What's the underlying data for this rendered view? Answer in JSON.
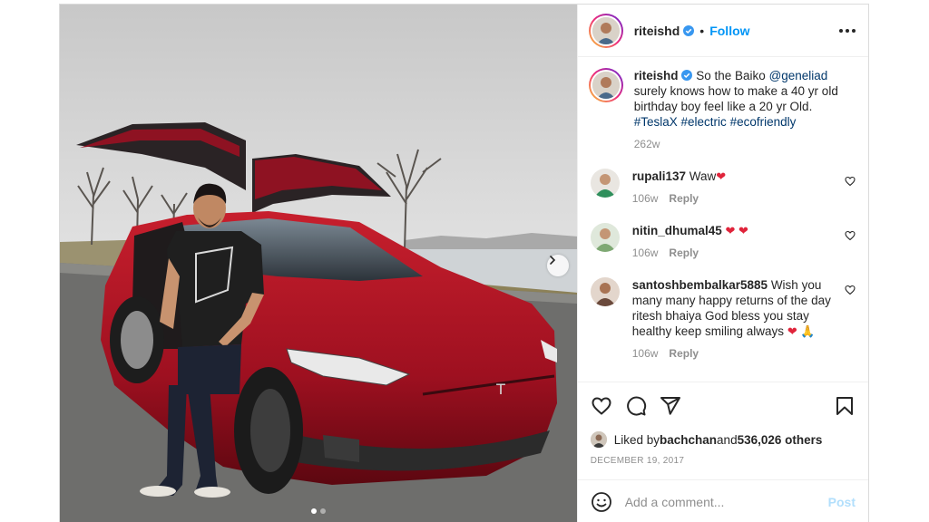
{
  "post": {
    "author": "riteishd",
    "follow_label": "Follow",
    "separator": "•",
    "photo_alt": "Man in black t-shirt leaning on a red Tesla Model X with falcon-wing doors open by a lake",
    "carousel": {
      "count": 2,
      "active_index": 0
    }
  },
  "caption": {
    "author": "riteishd",
    "text_before": "So the Baiko ",
    "mention": "@geneliad",
    "text_after": " surely knows how to make a 40 yr old birthday boy feel like a 20 yr Old. ",
    "hashtags": [
      "#TeslaX",
      "#electric",
      "#ecofriendly"
    ],
    "age": "262w"
  },
  "comments": [
    {
      "user": "rupali137",
      "text": "Waw",
      "emoji": "❤",
      "age": "106w",
      "reply_label": "Reply",
      "avatar_color": "#2f8f5c"
    },
    {
      "user": "nitin_dhumal45",
      "text": "",
      "emoji": "❤ ❤",
      "age": "106w",
      "reply_label": "Reply",
      "avatar_color": "#7ea873"
    },
    {
      "user": "santoshbembalkar5885",
      "text": "Wish you many many happy returns of the day ritesh bhaiya God bless you stay healthy keep smiling always",
      "emoji": "❤ 🙏",
      "age": "106w",
      "reply_label": "Reply",
      "avatar_color": "#6b4a3c"
    }
  ],
  "likes": {
    "prefix": "Liked by ",
    "user": "bachchan",
    "middle": " and ",
    "others": "536,026 others"
  },
  "date": "DECEMBER 19, 2017",
  "add_comment": {
    "placeholder": "Add a comment...",
    "post_label": "Post"
  },
  "colors": {
    "link": "#0095f6",
    "tag": "#00376b",
    "muted": "#8e8e8e",
    "border": "#dbdbdb"
  },
  "icons": [
    "verified-badge-icon",
    "more-options-icon",
    "heart-icon",
    "comment-icon",
    "share-icon",
    "bookmark-icon",
    "emoji-icon",
    "chevron-right-icon"
  ]
}
